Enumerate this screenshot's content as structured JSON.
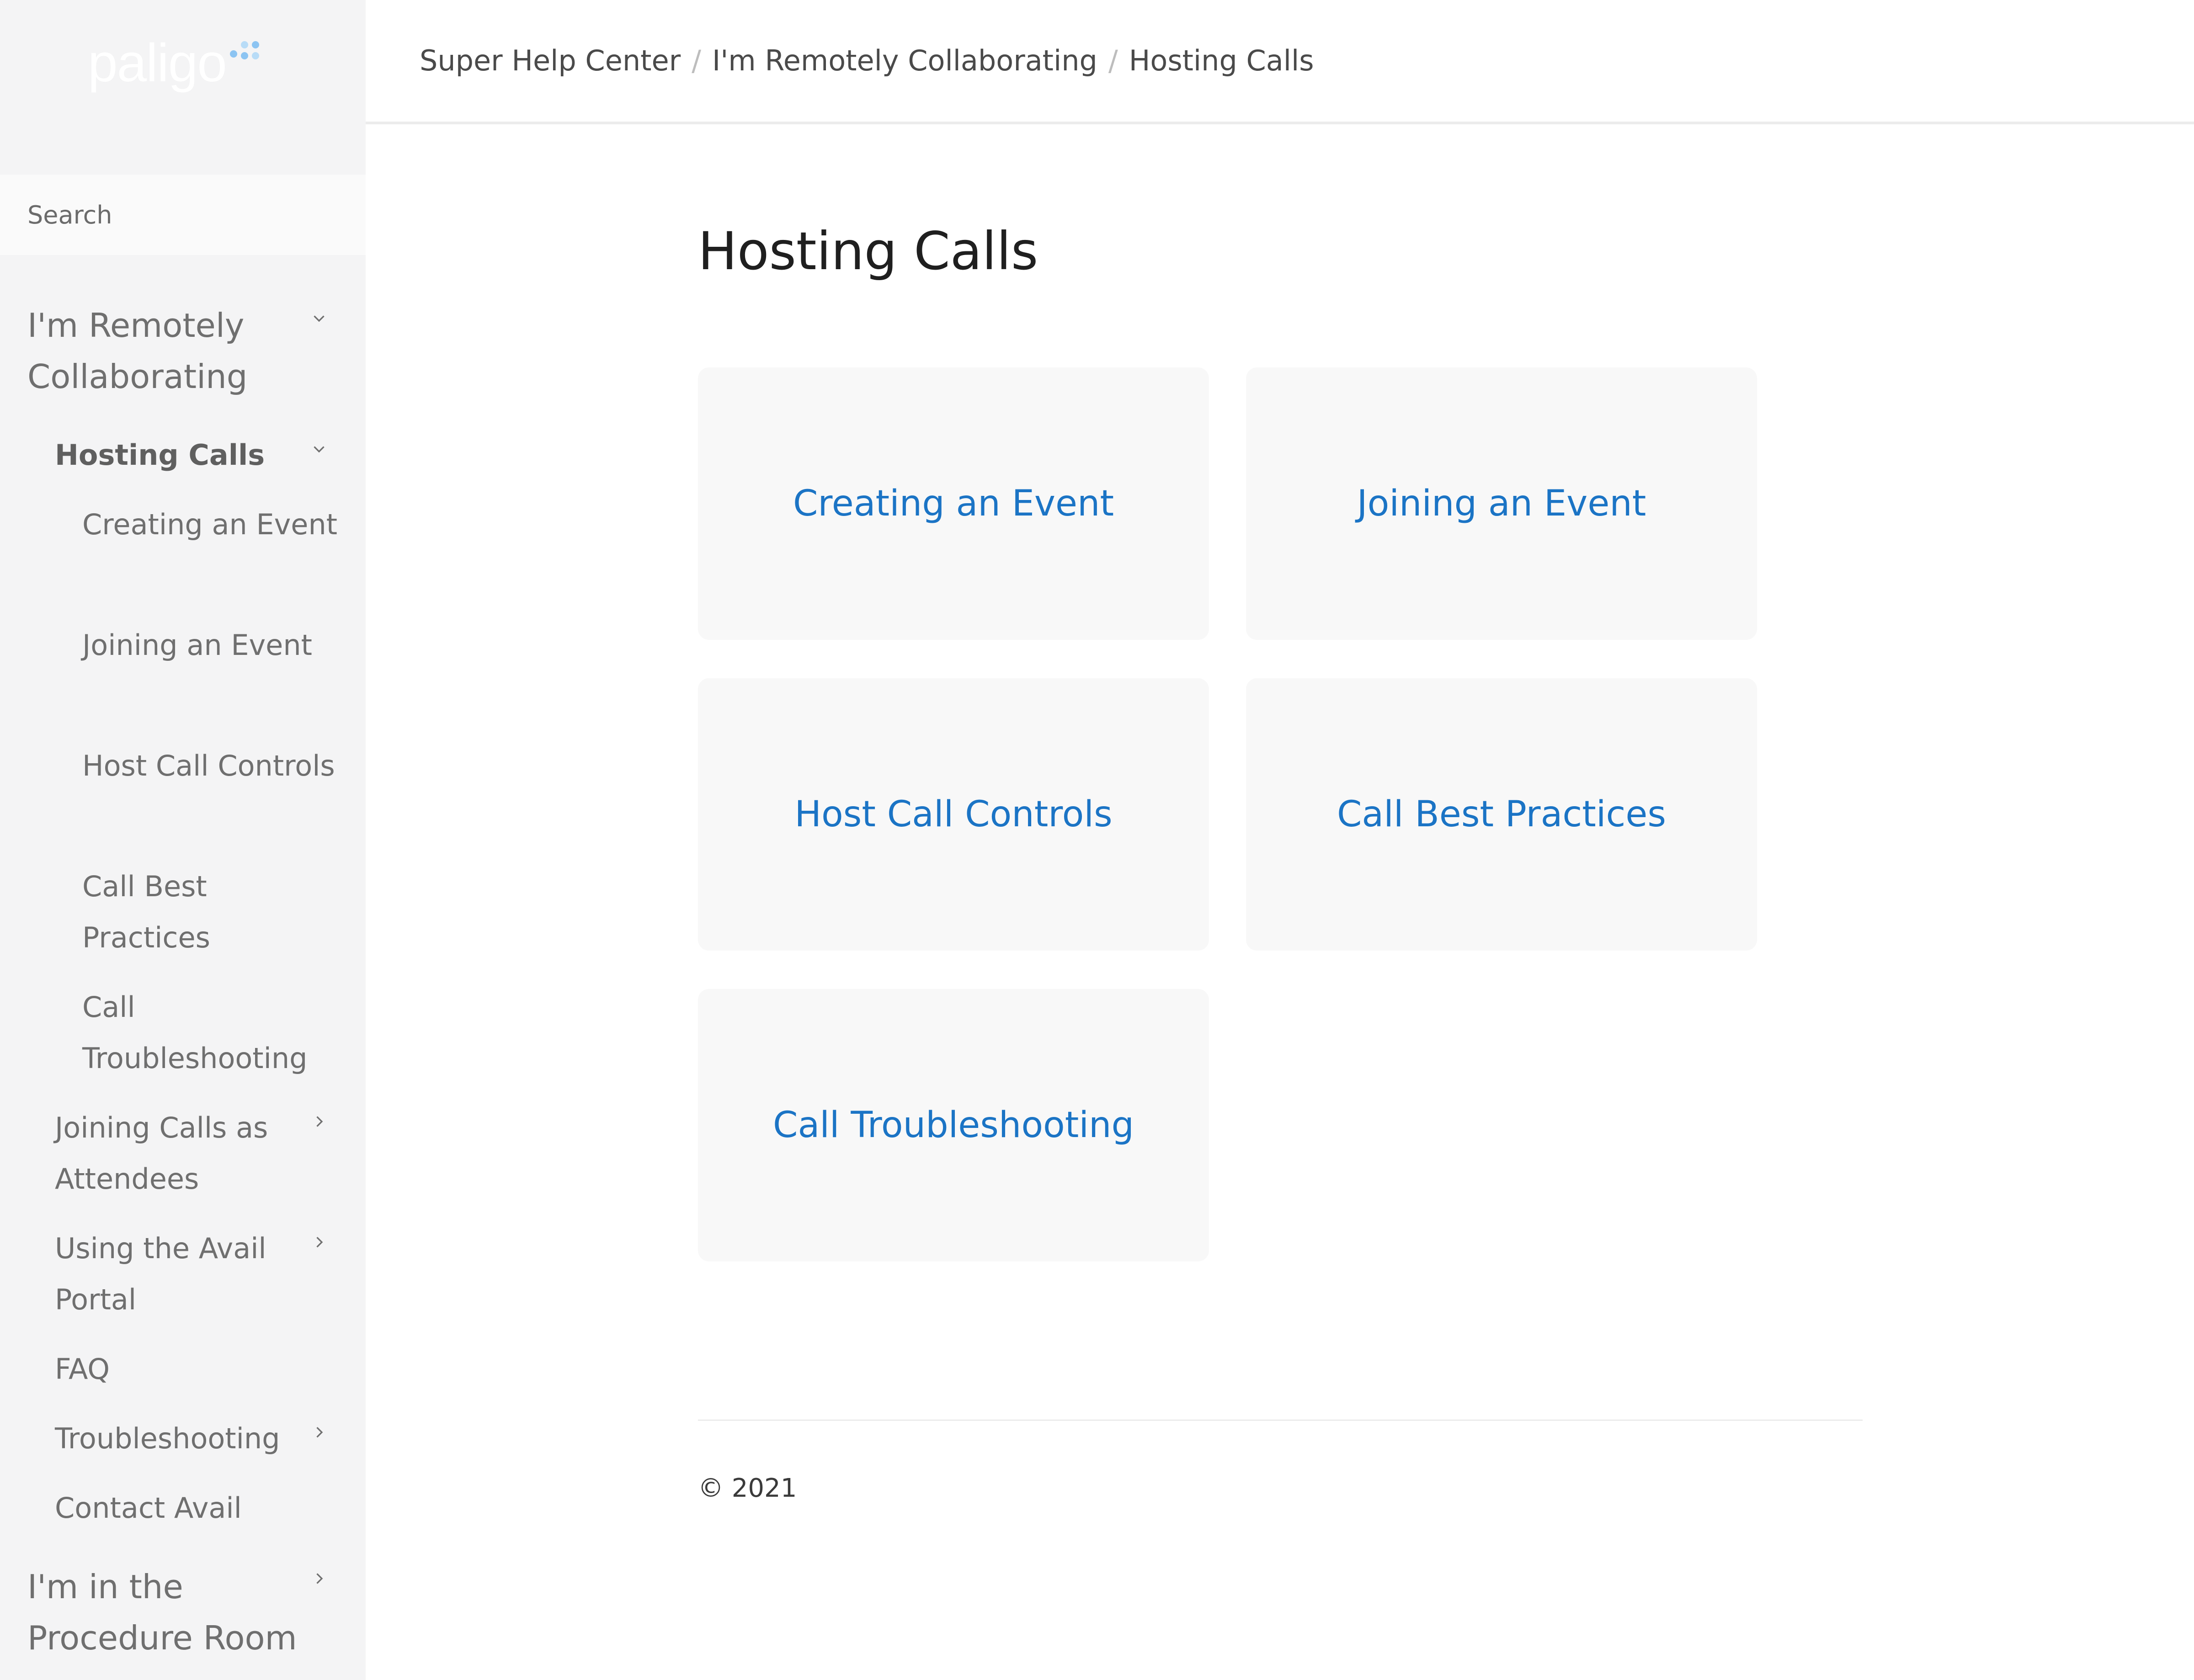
{
  "logo": {
    "text": "paligo"
  },
  "search": {
    "placeholder": "Search"
  },
  "sidebar": {
    "section1": "I'm Remotely Collaborating",
    "hosting_calls": "Hosting Calls",
    "sub": [
      "Creating an Event",
      "Joining an Event",
      "Host Call Controls",
      "Call Best Practices",
      "Call Troubleshooting"
    ],
    "joining_calls": "Joining Calls as Attendees",
    "avail_portal": "Using the Avail Portal",
    "faq": "FAQ",
    "troubleshooting": "Troubleshooting",
    "contact": "Contact Avail",
    "section2": "I'm in the Procedure Room"
  },
  "breadcrumb": [
    "Super Help Center",
    "I'm Remotely Collaborating",
    "Hosting Calls"
  ],
  "main": {
    "title": "Hosting Calls",
    "cards": [
      "Creating an Event",
      "Joining an Event",
      "Host Call Controls",
      "Call Best Practices",
      "Call Troubleshooting"
    ]
  },
  "footer": {
    "copyright": "© 2021"
  },
  "colors": {
    "link": "#1b74c5",
    "sidebar_bg": "#f4f4f5",
    "card_bg": "#f8f8f8",
    "logo_dot": "#8cc4f2"
  }
}
